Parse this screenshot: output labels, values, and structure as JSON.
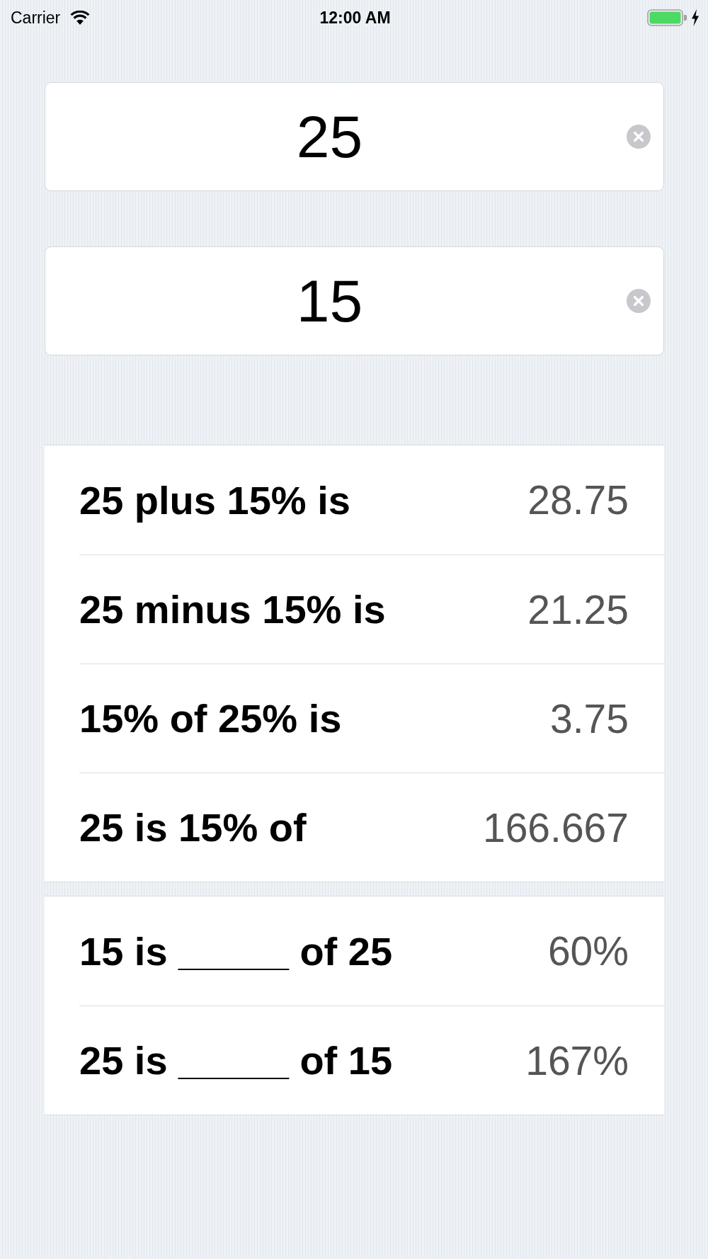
{
  "status_bar": {
    "carrier": "Carrier",
    "time": "12:00 AM",
    "charging": true
  },
  "fields": [
    {
      "value": "25"
    },
    {
      "value": "15"
    }
  ],
  "sections": [
    {
      "rows": [
        {
          "label": "25 plus 15% is",
          "value": "28.75"
        },
        {
          "label": "25 minus 15% is",
          "value": "21.25"
        },
        {
          "label": "15% of 25% is",
          "value": "3.75"
        },
        {
          "label": "25 is 15% of",
          "value": "166.667"
        }
      ]
    },
    {
      "rows": [
        {
          "label": "15 is _____ of 25",
          "value": "60%"
        },
        {
          "label": "25 is _____ of 15",
          "value": "167%"
        }
      ]
    }
  ]
}
